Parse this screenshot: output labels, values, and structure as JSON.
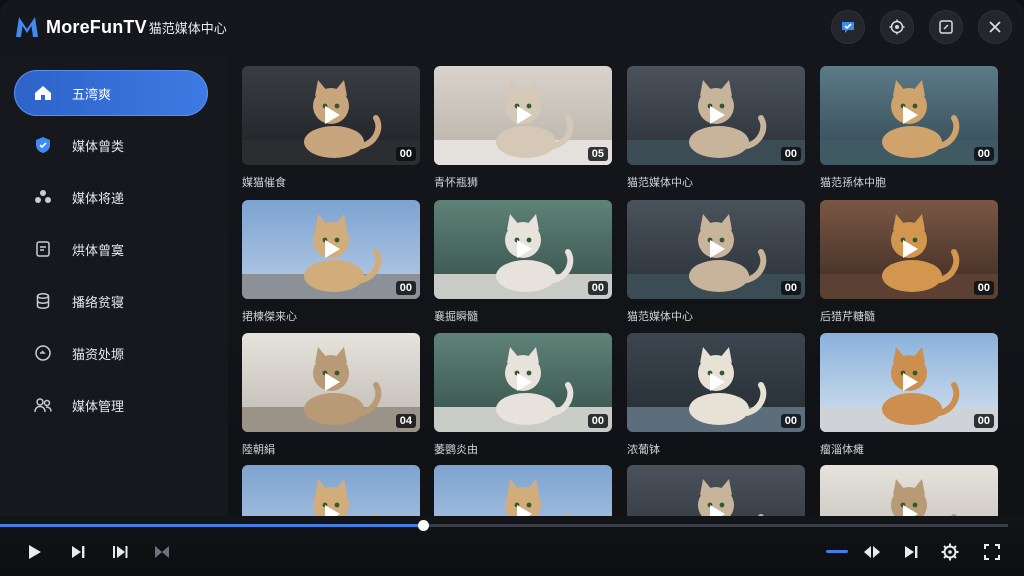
{
  "app": {
    "brand_name": "MoreFunTV",
    "brand_subtitle": "猫范媒体中心",
    "accent_color": "#3e7ae3"
  },
  "window_controls": [
    {
      "name": "chat-icon"
    },
    {
      "name": "settings-icon"
    },
    {
      "name": "edit-icon"
    },
    {
      "name": "close-icon"
    }
  ],
  "sidebar": {
    "items": [
      {
        "label": "五湾爽",
        "icon": "home-icon",
        "active": true
      },
      {
        "label": "媒体曾类",
        "icon": "shield-icon",
        "active": false
      },
      {
        "label": "媒体将递",
        "icon": "people-icon",
        "active": false
      },
      {
        "label": "烘体曾寞",
        "icon": "document-icon",
        "active": false
      },
      {
        "label": "播络贫寝",
        "icon": "database-icon",
        "active": false
      },
      {
        "label": "猫资处塬",
        "icon": "circle-icon",
        "active": false
      },
      {
        "label": "媒体管理",
        "icon": "users-icon",
        "active": false
      }
    ]
  },
  "grid": {
    "cards": [
      {
        "caption": "媒猫催食",
        "duration": "00",
        "scene": "dark"
      },
      {
        "caption": "青怀瓶狮",
        "duration": "05",
        "scene": "bed"
      },
      {
        "caption": "猫范媒体中心",
        "duration": "00",
        "scene": "room"
      },
      {
        "caption": "猫范孫体中胞",
        "duration": "00",
        "scene": "teal"
      },
      {
        "caption": "捃楝傑来心",
        "duration": "00",
        "scene": "sky"
      },
      {
        "caption": "襄掘瞬髓",
        "duration": "00",
        "scene": "green"
      },
      {
        "caption": "猫范媒体中心",
        "duration": "00",
        "scene": "room"
      },
      {
        "caption": "后猎芹糖髓",
        "duration": "00",
        "scene": "warm"
      },
      {
        "caption": "陸朝絹",
        "duration": "04",
        "scene": "white"
      },
      {
        "caption": "萎鹦炎由",
        "duration": "00",
        "scene": "green"
      },
      {
        "caption": "浓葡钵",
        "duration": "00",
        "scene": "lamp"
      },
      {
        "caption": "瘤淄体瘫",
        "duration": "00",
        "scene": "city"
      },
      {
        "caption": "",
        "duration": "",
        "scene": "sky"
      },
      {
        "caption": "",
        "duration": "",
        "scene": "sky"
      },
      {
        "caption": "",
        "duration": "",
        "scene": "room"
      },
      {
        "caption": "",
        "duration": "",
        "scene": "white"
      }
    ]
  },
  "player": {
    "progress": 0.42,
    "controls": [
      "play-icon",
      "next-icon",
      "skip-next-icon",
      "crossfade-icon",
      "volume-slider",
      "rewind-icon",
      "end-icon",
      "settings-icon",
      "fullscreen-icon"
    ]
  }
}
